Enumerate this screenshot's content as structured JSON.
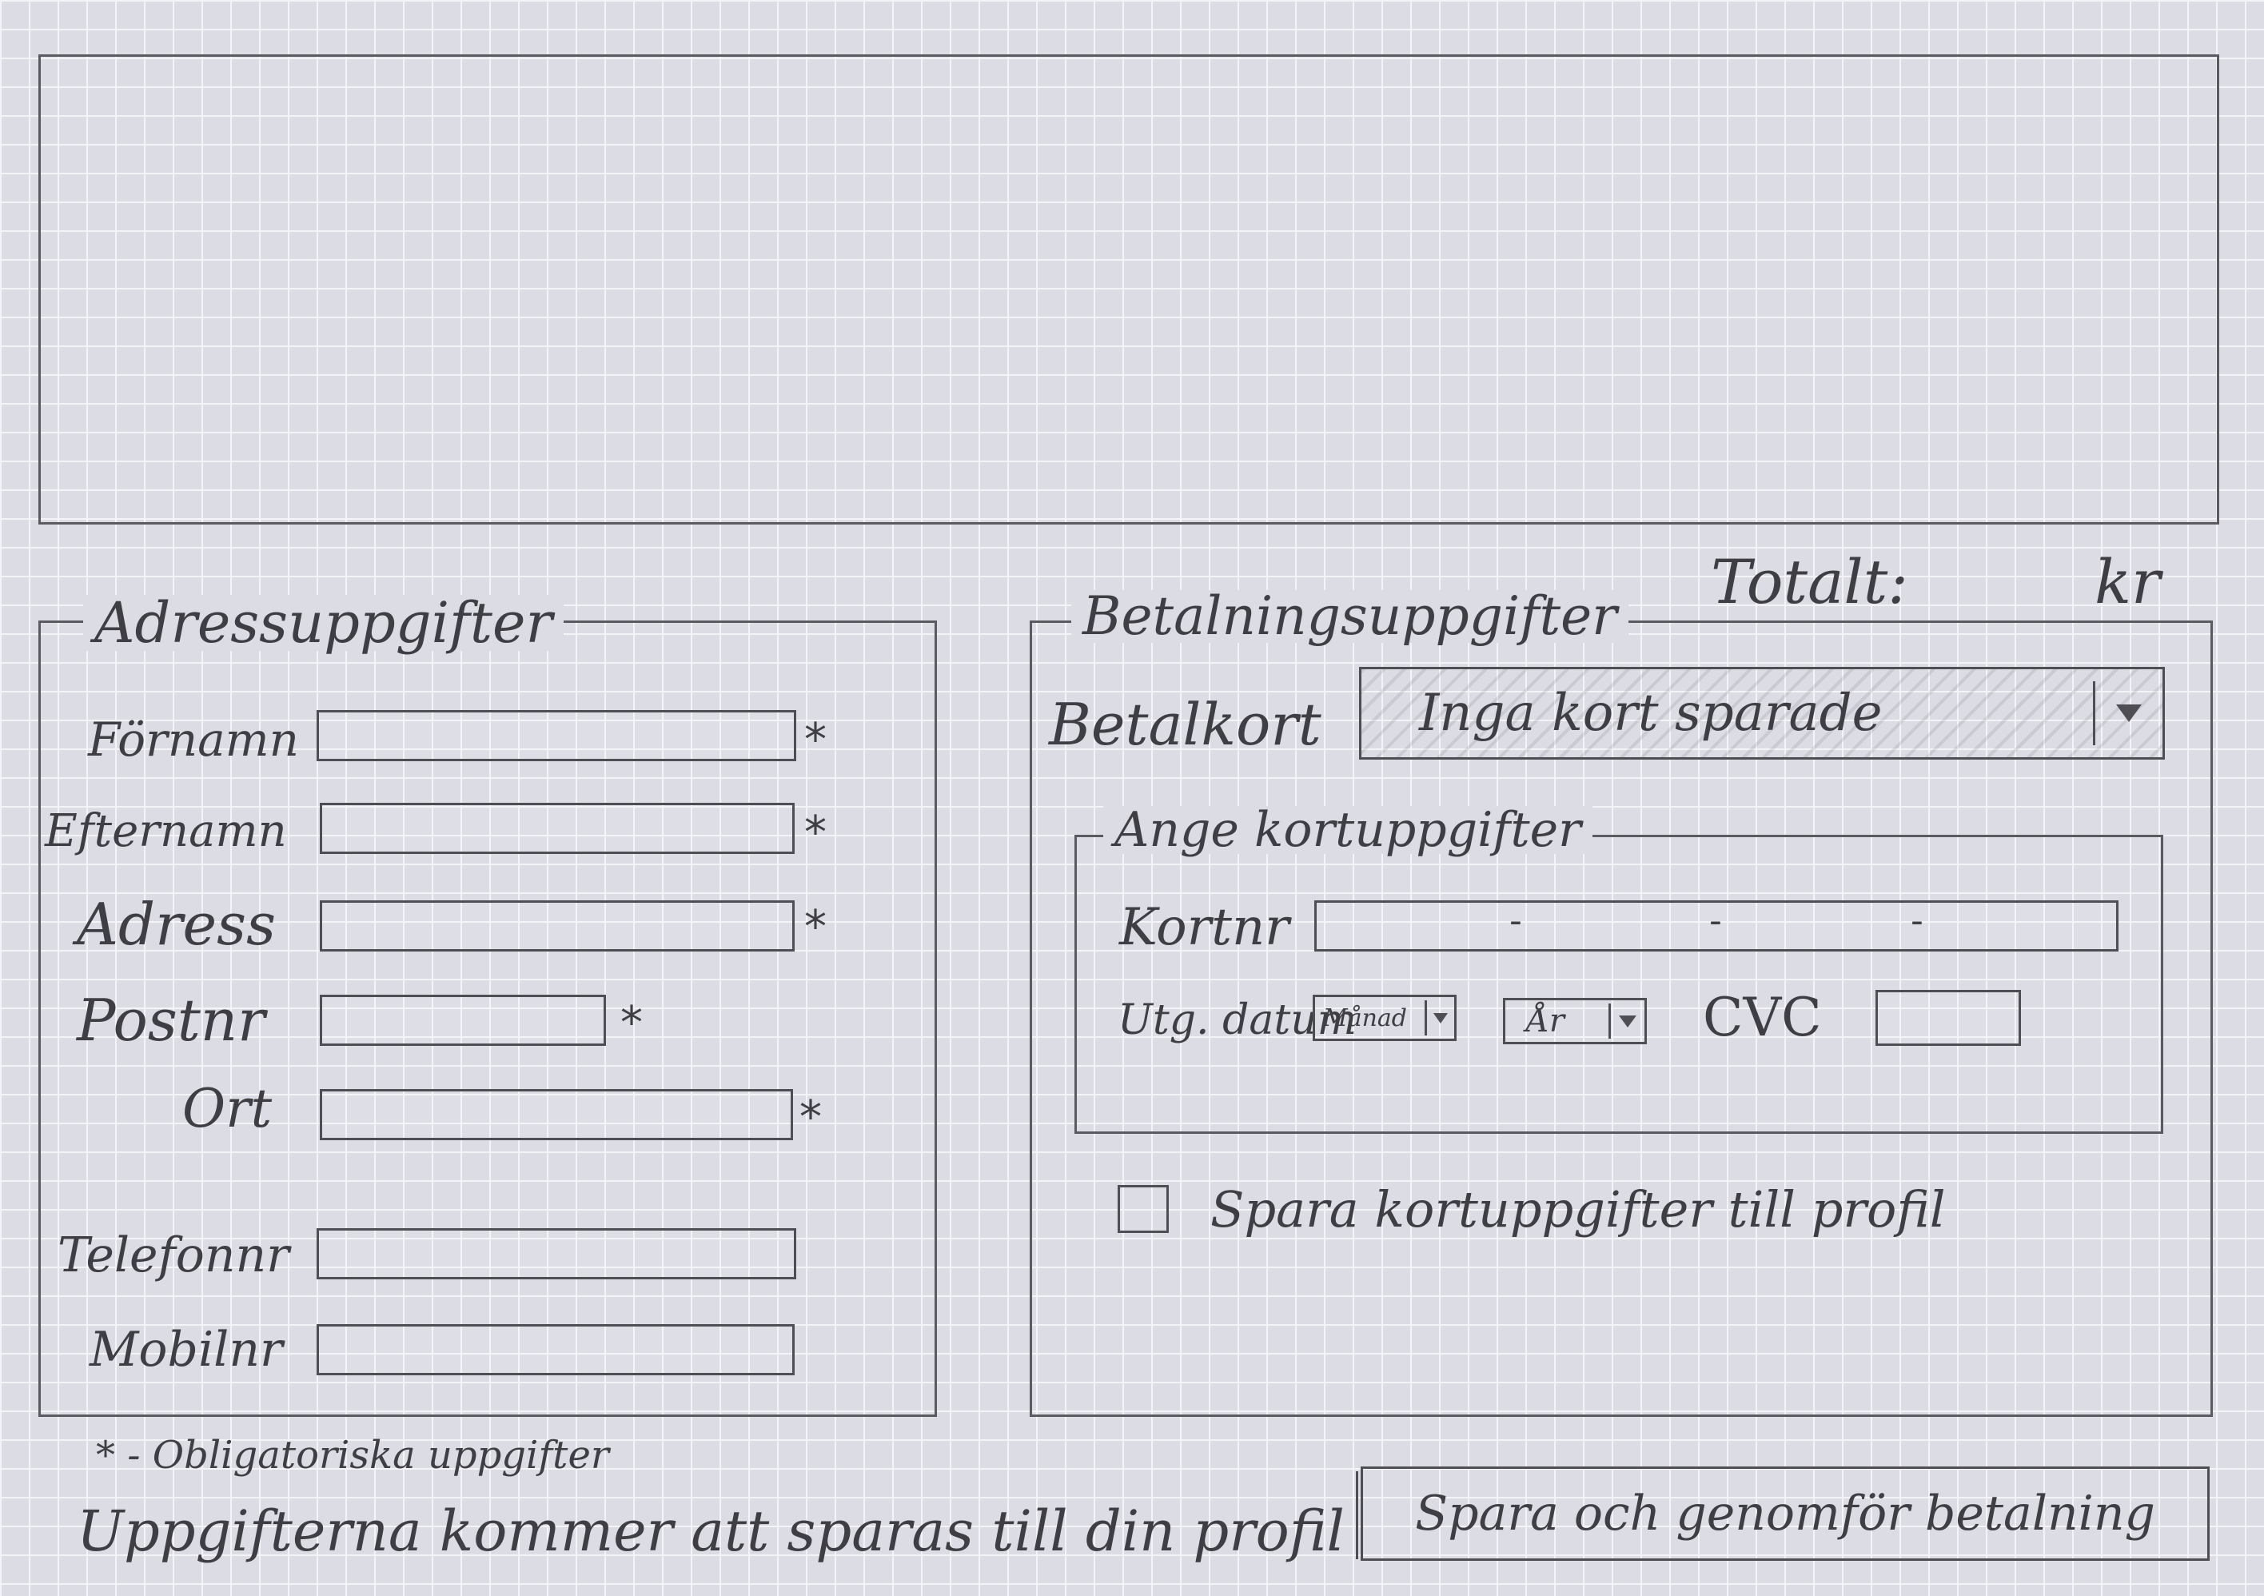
{
  "header_area": {},
  "total": {
    "label": "Totalt:",
    "currency": "kr"
  },
  "address": {
    "title": "Adressuppgifter",
    "fields": {
      "firstname": "Förnamn",
      "lastname": "Efternamn",
      "address": "Adress",
      "postnr": "Postnr",
      "city": "Ort",
      "phone": "Telefonnr",
      "mobile": "Mobilnr"
    },
    "required_mark": "*",
    "required_note": "* - Obligatoriska uppgifter"
  },
  "payment": {
    "title": "Betalningsuppgifter",
    "card_label": "Betalkort",
    "card_select_value": "Inga kort sparade",
    "card_details": {
      "title": "Ange kortuppgifter",
      "cardnr_label": "Kortnr",
      "cardnr_separators": [
        "-",
        "-",
        "-"
      ],
      "expiry_label": "Utg. datum",
      "month_value": "Månad",
      "year_value": "År",
      "cvc_label": "CVC"
    },
    "save_card_label": "Spara kortuppgifter till profil"
  },
  "footer": {
    "note": "Uppgifterna kommer att sparas till din profil",
    "submit_label": "Spara och genomför betalning"
  }
}
